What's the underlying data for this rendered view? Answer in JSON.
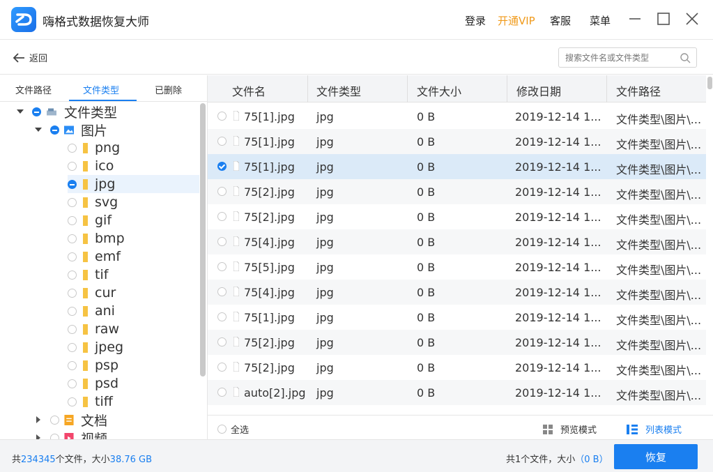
{
  "app": {
    "title": "嗨格式数据恢复大师"
  },
  "titlebar": {
    "login": "登录",
    "vip": "开通VIP",
    "service": "客服",
    "menu": "菜单"
  },
  "subbar": {
    "back_label": "返回",
    "search_placeholder": "搜索文件名或文件类型"
  },
  "tabs": [
    {
      "label": "文件路径",
      "active": false
    },
    {
      "label": "文件类型",
      "active": true
    },
    {
      "label": "已删除",
      "active": false
    }
  ],
  "tree": {
    "root": {
      "label": "文件类型"
    },
    "images": {
      "label": "图片"
    },
    "image_types": [
      "png",
      "ico",
      "jpg",
      "svg",
      "gif",
      "bmp",
      "emf",
      "tif",
      "cur",
      "ani",
      "raw",
      "jpeg",
      "psp",
      "psd",
      "tiff"
    ],
    "selected_type": "jpg",
    "docs": {
      "label": "文档"
    },
    "video": {
      "label": "视频"
    }
  },
  "table": {
    "columns": [
      "文件名",
      "文件类型",
      "文件大小",
      "修改日期",
      "文件路径"
    ],
    "rows": [
      {
        "name": "75[1].jpg",
        "type": "jpg",
        "size": "0 B",
        "date": "2019-12-14 1...",
        "path": "文件类型\\图片\\...",
        "checked": false
      },
      {
        "name": "75[1].jpg",
        "type": "jpg",
        "size": "0 B",
        "date": "2019-12-14 1...",
        "path": "文件类型\\图片\\...",
        "checked": false
      },
      {
        "name": "75[1].jpg",
        "type": "jpg",
        "size": "0 B",
        "date": "2019-12-14 1...",
        "path": "文件类型\\图片\\...",
        "checked": true
      },
      {
        "name": "75[2].jpg",
        "type": "jpg",
        "size": "0 B",
        "date": "2019-12-14 1...",
        "path": "文件类型\\图片\\...",
        "checked": false
      },
      {
        "name": "75[2].jpg",
        "type": "jpg",
        "size": "0 B",
        "date": "2019-12-14 1...",
        "path": "文件类型\\图片\\...",
        "checked": false
      },
      {
        "name": "75[4].jpg",
        "type": "jpg",
        "size": "0 B",
        "date": "2019-12-14 1...",
        "path": "文件类型\\图片\\...",
        "checked": false
      },
      {
        "name": "75[5].jpg",
        "type": "jpg",
        "size": "0 B",
        "date": "2019-12-14 1...",
        "path": "文件类型\\图片\\...",
        "checked": false
      },
      {
        "name": "75[4].jpg",
        "type": "jpg",
        "size": "0 B",
        "date": "2019-12-14 1...",
        "path": "文件类型\\图片\\...",
        "checked": false
      },
      {
        "name": "75[1].jpg",
        "type": "jpg",
        "size": "0 B",
        "date": "2019-12-14 1...",
        "path": "文件类型\\图片\\...",
        "checked": false
      },
      {
        "name": "75[2].jpg",
        "type": "jpg",
        "size": "0 B",
        "date": "2019-12-14 1...",
        "path": "文件类型\\图片\\...",
        "checked": false
      },
      {
        "name": "75[2].jpg",
        "type": "jpg",
        "size": "0 B",
        "date": "2019-12-14 1...",
        "path": "文件类型\\图片\\...",
        "checked": false
      },
      {
        "name": "auto[2].jpg",
        "type": "jpg",
        "size": "0 B",
        "date": "2019-12-14 1...",
        "path": "文件类型\\图片\\...",
        "checked": false
      }
    ]
  },
  "footer": {
    "select_all": "全选",
    "preview_mode": "预览模式",
    "list_mode": "列表模式"
  },
  "status": {
    "total_prefix": "共",
    "total_count": "234345",
    "total_mid": "个文件，大小",
    "total_size": "38.76 GB",
    "selected_prefix": "共1个文件，大小",
    "selected_size": "（0 B）",
    "recover_label": "恢复"
  },
  "colors": {
    "accent": "#1a7ff0",
    "vip": "#f09a1b",
    "selected_row": "#dbeaf8"
  }
}
